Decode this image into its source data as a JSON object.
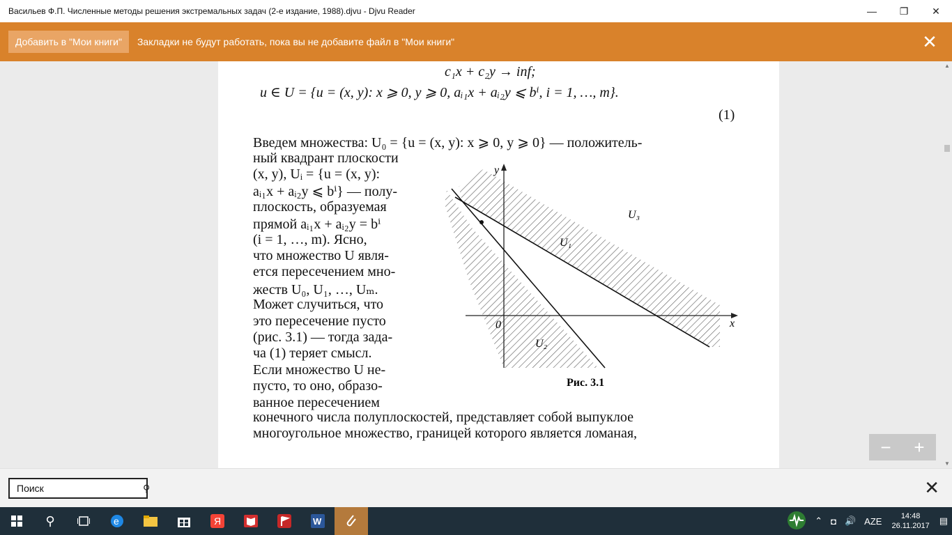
{
  "window": {
    "title": "Васильев Ф.П. Численные методы решения экстремальных задач (2-е издание, 1988).djvu - Djvu Reader",
    "minimize": "—",
    "maximize": "❐",
    "close": "✕"
  },
  "notice": {
    "add_button": "Добавить в \"Мои книги\"",
    "message": "Закладки не будут работать, пока вы не добавите файл в \"Мои книги\"",
    "close": "✕"
  },
  "document": {
    "lines": [
      "c₁x + c₂y → inf;",
      "u ∈ U = {u = (x, y): x ⩾ 0, y ⩾ 0, aᵢ₁x + aᵢ₂y ⩽ bⁱ, i = 1, …, m}.",
      "(1)",
      "Введем множества: U₀ = {u = (x, y): x ⩾ 0, y ⩾ 0} — положитель-",
      "ный квадрант плоскости",
      "(x, y), Uᵢ = {u = (x, y):",
      "aᵢ₁x + aᵢ₂y ⩽ bⁱ} — полу-",
      "плоскость, образуемая",
      "прямой    aᵢ₁x + aᵢ₂y = bⁱ",
      "(i = 1, …, m). Ясно,",
      "что множество U явля-",
      "ется пересечением мно-",
      "жеств U₀, U₁, …, Uₘ.",
      "Может случиться, что",
      "это пересечение пусто",
      "(рис. 3.1) — тогда зада-",
      "ча (1) теряет смысл.",
      "Если множество U не-",
      "пусто, то оно, образо-",
      "ванное пересечением",
      "конечного числа полуплоскостей, представляет собой выпуклое",
      "многоугольное множество, границей которого является ломаная,"
    ],
    "figure": {
      "caption": "Рис. 3.1",
      "axis_x": "x",
      "axis_y": "y",
      "origin": "0",
      "label_u1": "U₁",
      "label_u2": "U₂",
      "label_u3": "U₃"
    }
  },
  "zoom": {
    "minus": "−",
    "plus": "+"
  },
  "search": {
    "placeholder": "Поиск",
    "close": "✕"
  },
  "taskbar": {
    "language": "AZE",
    "time": "14:48",
    "date": "26.11.2017"
  }
}
